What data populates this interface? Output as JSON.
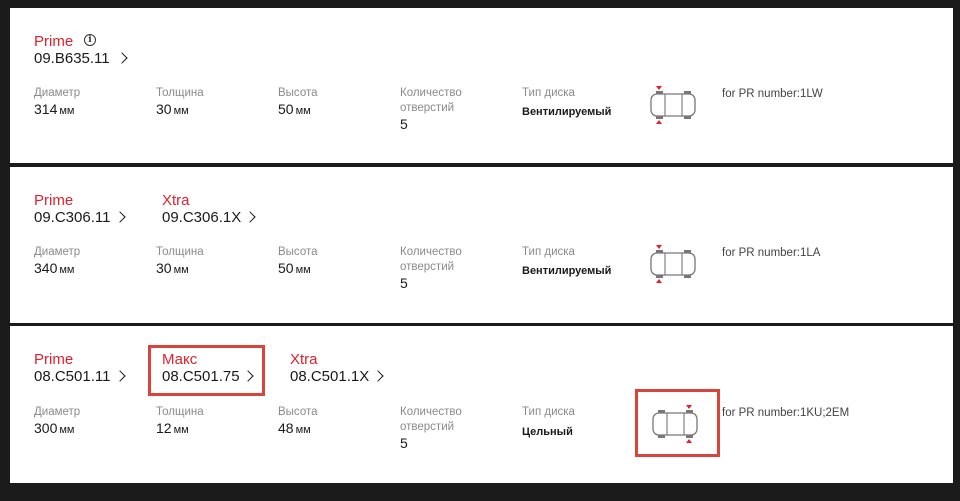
{
  "labels": {
    "diameter": "Диаметр",
    "thickness": "Толщина",
    "height": "Высота",
    "holes_line1": "Количество",
    "holes_line2": "отверстий",
    "disc_type": "Тип диска",
    "unit": "мм"
  },
  "cards": [
    {
      "parts": [
        {
          "brand": "Prime",
          "number": "09.B635.11"
        }
      ],
      "diameter": "314",
      "thickness": "30",
      "height": "50",
      "holes": "5",
      "disc_type": "Вентилируемый",
      "pr": "for PR number:1LW",
      "axle": "front"
    },
    {
      "parts": [
        {
          "brand": "Prime",
          "number": "09.C306.11"
        },
        {
          "brand": "Xtra",
          "number": "09.C306.1X"
        }
      ],
      "diameter": "340",
      "thickness": "30",
      "height": "50",
      "holes": "5",
      "disc_type": "Вентилируемый",
      "pr": "for PR number:1LA",
      "axle": "front"
    },
    {
      "parts": [
        {
          "brand": "Prime",
          "number": "08.C501.11"
        },
        {
          "brand": "Макс",
          "number": "08.C501.75"
        },
        {
          "brand": "Xtra",
          "number": "08.C501.1X"
        }
      ],
      "diameter": "300",
      "thickness": "12",
      "height": "48",
      "holes": "5",
      "disc_type": "Цельный",
      "pr": "for PR number:1KU;2EM",
      "axle": "rear"
    }
  ],
  "colors": {
    "brand_red": "#e4202c",
    "highlight": "#d9453a",
    "background": "#1b1b1b"
  },
  "icons": {
    "info": "info-icon",
    "chevron": "chevron-right-icon",
    "car": "car-axle-icon"
  }
}
